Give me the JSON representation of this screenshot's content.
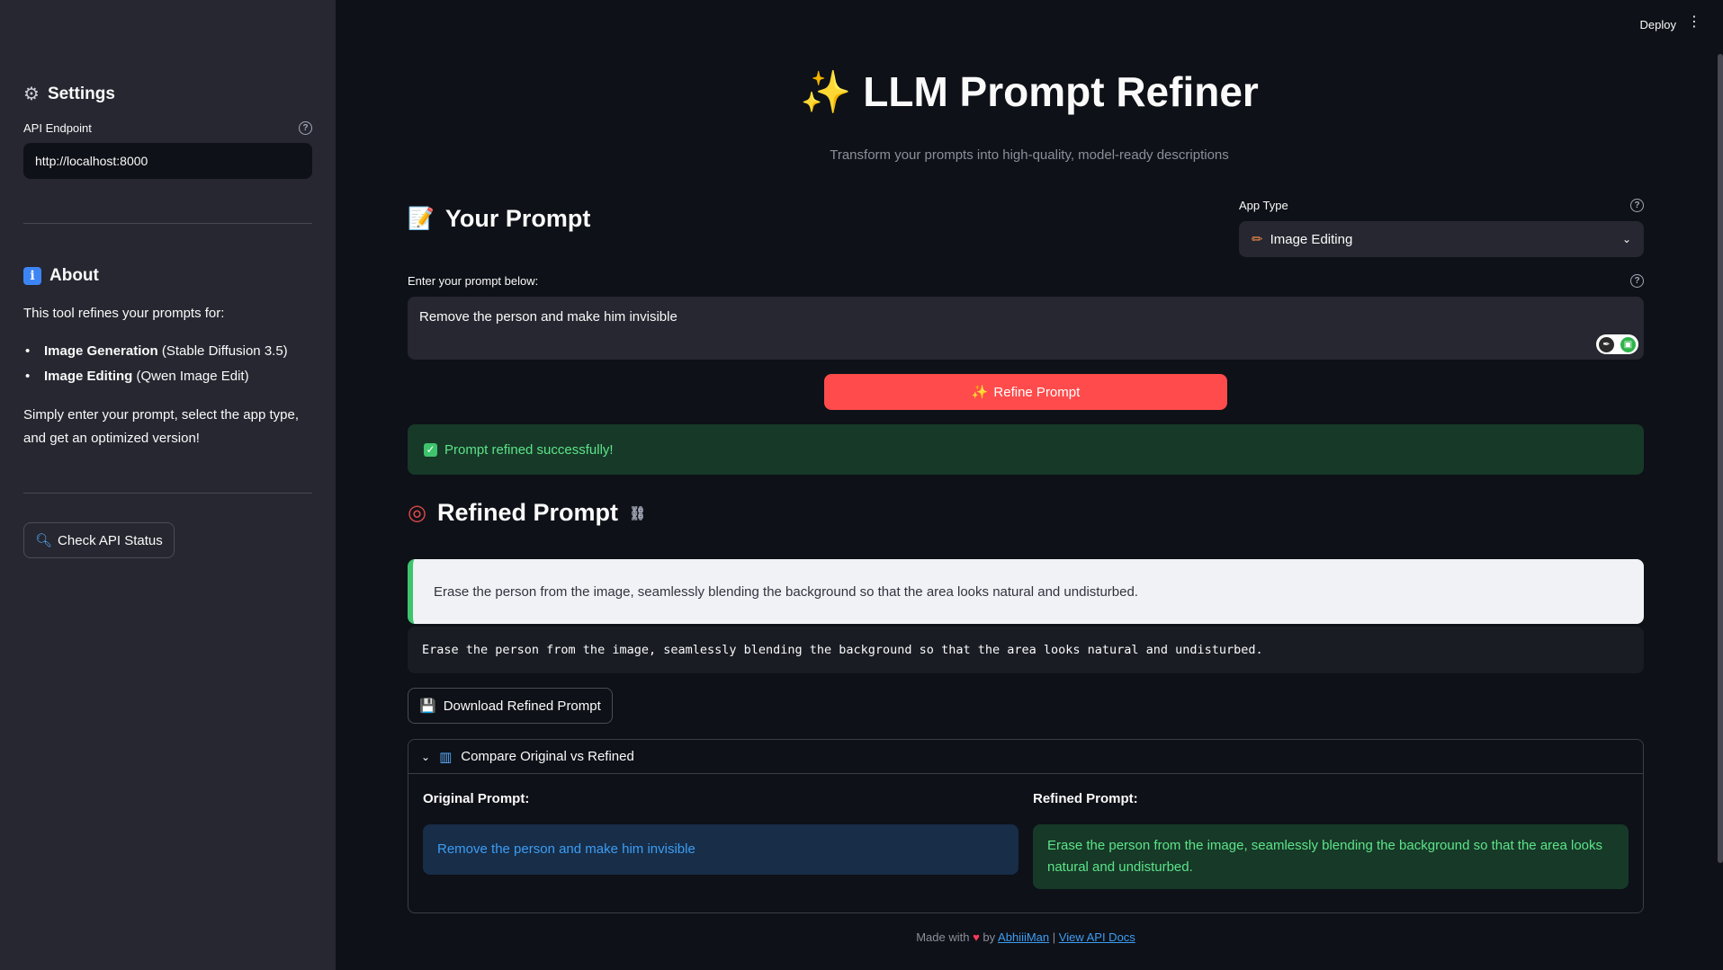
{
  "sidebar": {
    "settings_title": "Settings",
    "api_label": "API Endpoint",
    "api_value": "http://localhost:8000",
    "about_title": "About",
    "about_intro": "This tool refines your prompts for:",
    "items": [
      {
        "bold": "Image Generation",
        "rest": " (Stable Diffusion 3.5)"
      },
      {
        "bold": "Image Editing",
        "rest": " (Qwen Image Edit)"
      }
    ],
    "about_outro_1": "Simply enter your prompt, select the app type,",
    "about_outro_2": "and get an optimized version!",
    "check_button": "Check API Status"
  },
  "header": {
    "deploy": "Deploy",
    "title": "LLM Prompt Refiner",
    "subtitle": "Transform your prompts into high-quality, model-ready descriptions"
  },
  "prompt_section": {
    "heading": "Your Prompt",
    "input_label": "Enter your prompt below:",
    "input_value": "Remove the person and make him invisible",
    "app_type_label": "App Type",
    "app_type_value": "Image Editing",
    "refine_button": "Refine Prompt"
  },
  "status": {
    "success_text": "Prompt refined successfully!"
  },
  "refined_section": {
    "heading": "Refined Prompt",
    "text": "Erase the person from the image, seamlessly blending the background so that the area looks natural and undisturbed.",
    "code_text": "Erase the person from the image, seamlessly blending the background so that the area looks natural and undisturbed.",
    "download_button": "Download Refined Prompt"
  },
  "compare": {
    "title": "Compare Original vs Refined",
    "original_label": "Original Prompt:",
    "original_text": "Remove the person and make him invisible",
    "refined_label": "Refined Prompt:",
    "refined_text": "Erase the person from the image, seamlessly blending the background so that the area looks natural and undisturbed."
  },
  "footer": {
    "made_with": "Made with",
    "by": "by",
    "author": "AbhiiiMan",
    "separator": "|",
    "api_docs": "View API Docs"
  },
  "colors": {
    "background": "#0e1117",
    "sidebar": "#262730",
    "primary": "#ff4b4b",
    "success_bg": "#173928",
    "success_text": "#5ce488",
    "info_bg": "#172d48",
    "info_text": "#3d9df3"
  }
}
